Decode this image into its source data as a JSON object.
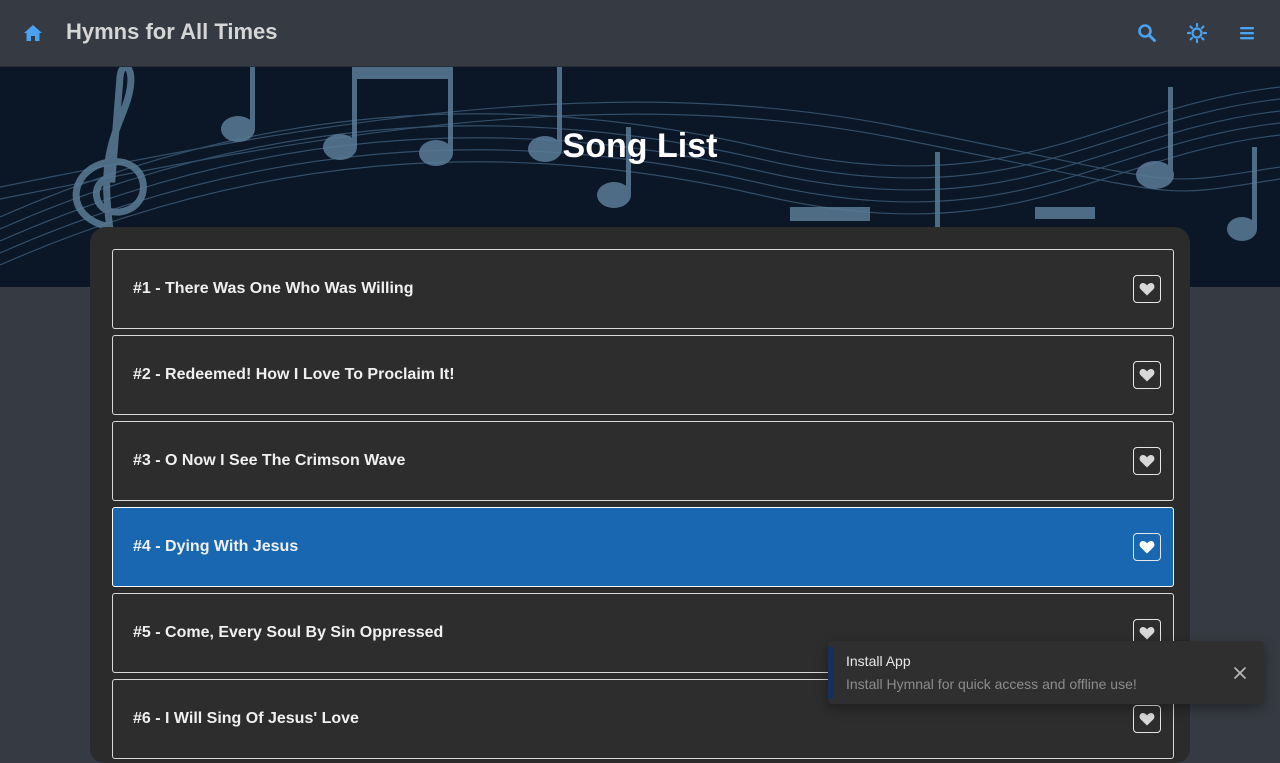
{
  "navbar": {
    "title": "Hymns for All Times",
    "icons": {
      "home": "home-icon",
      "search": "search-icon",
      "theme": "sun-icon",
      "menu": "hamburger-menu-icon"
    },
    "accent_color": "#4aa3f0"
  },
  "hero": {
    "title": "Song List"
  },
  "songs": [
    {
      "label": "#1 - There Was One Who Was Willing",
      "active": false
    },
    {
      "label": "#2 - Redeemed! How I Love To Proclaim It!",
      "active": false
    },
    {
      "label": "#3 - O Now I See The Crimson Wave",
      "active": false
    },
    {
      "label": "#4 - Dying With Jesus",
      "active": true
    },
    {
      "label": "#5 - Come, Every Soul By Sin Oppressed",
      "active": false
    },
    {
      "label": "#6 - I Will Sing Of Jesus' Love",
      "active": false
    }
  ],
  "colors": {
    "active_row": "#1867b0",
    "panel": "#2b2b2b",
    "page": "#363a42"
  },
  "toast": {
    "title": "Install App",
    "body": "Install Hymnal for quick access and offline use!",
    "close_icon": "close-icon"
  }
}
